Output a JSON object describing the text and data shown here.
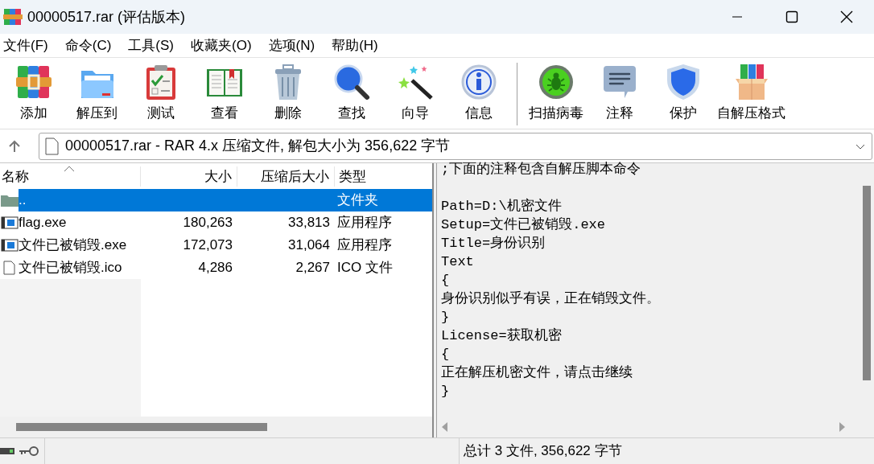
{
  "window": {
    "title": "00000517.rar (评估版本)"
  },
  "menu": [
    "文件(F)",
    "命令(C)",
    "工具(S)",
    "收藏夹(O)",
    "选项(N)",
    "帮助(H)"
  ],
  "toolbar": [
    {
      "kind": "add",
      "label": "添加"
    },
    {
      "kind": "extract",
      "label": "解压到"
    },
    {
      "kind": "test",
      "label": "测试"
    },
    {
      "kind": "view",
      "label": "查看"
    },
    {
      "kind": "delete",
      "label": "删除"
    },
    {
      "kind": "find",
      "label": "查找"
    },
    {
      "kind": "wizard",
      "label": "向导"
    },
    {
      "kind": "info",
      "label": "信息"
    },
    {
      "kind": "separator"
    },
    {
      "kind": "scan",
      "label": "扫描病毒"
    },
    {
      "kind": "comment",
      "label": "注释"
    },
    {
      "kind": "protect",
      "label": "保护"
    },
    {
      "kind": "sfx",
      "label": "自解压格式"
    }
  ],
  "address": {
    "value": "00000517.rar - RAR 4.x 压缩文件, 解包大小为 356,622 字节"
  },
  "table": {
    "columns": [
      "名称",
      "大小",
      "压缩后大小",
      "类型"
    ],
    "rows": [
      {
        "kind": "folder",
        "name": "..",
        "size": "",
        "packed": "",
        "type": "文件夹",
        "selected": true
      },
      {
        "kind": "exe",
        "name": "flag.exe",
        "size": "180,263",
        "packed": "33,813",
        "type": "应用程序",
        "selected": false
      },
      {
        "kind": "exe",
        "name": "文件已被销毁.exe",
        "size": "172,073",
        "packed": "31,064",
        "type": "应用程序",
        "selected": false
      },
      {
        "kind": "file",
        "name": "文件已被销毁.ico",
        "size": "4,286",
        "packed": "2,267",
        "type": "ICO 文件",
        "selected": false
      }
    ]
  },
  "comment": {
    "lines": [
      ";下面的注释包含自解压脚本命令",
      "Path=D:\\机密文件",
      "Setup=文件已被销毁.exe",
      "Title=身份识别",
      "Text",
      "{",
      "身份识别似乎有误，正在销毁文件。",
      "}",
      "License=获取机密",
      "{",
      "正在解压机密文件，请点击继续",
      "}"
    ]
  },
  "status_bar": {
    "text": "总计 3 文件, 356,622 字节"
  }
}
